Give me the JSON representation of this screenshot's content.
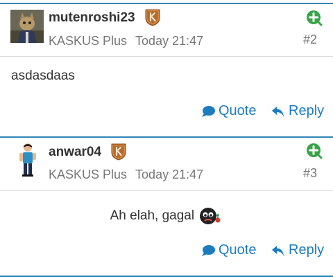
{
  "posts": [
    {
      "username": "mutenroshi23",
      "rank": "KASKUS Plus",
      "time": "Today 21:47",
      "post_number": "#2",
      "content": "asdasdaas",
      "quote_label": "Quote",
      "reply_label": "Reply"
    },
    {
      "username": "anwar04",
      "rank": "KASKUS Plus",
      "time": "Today 21:47",
      "post_number": "#3",
      "content": "Ah elah, gagal",
      "quote_label": "Quote",
      "reply_label": "Reply"
    }
  ],
  "colors": {
    "accent": "#1d7cc0",
    "divider": "#2f84b8",
    "plus_green": "#3aa34a",
    "badge_brown": "#b66a2c"
  },
  "icons": [
    "kaskus-plus-badge-icon",
    "plus-circle-icon",
    "speech-bubble-icon",
    "reply-arrow-icon",
    "crying-emoticon-icon"
  ]
}
